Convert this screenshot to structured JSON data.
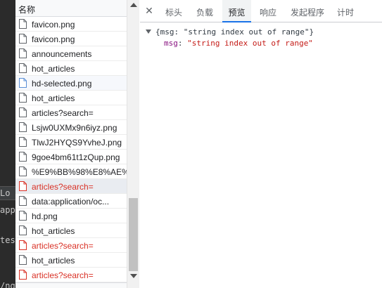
{
  "background_editor": {
    "lines": [
      "Lo",
      "app",
      "test",
      "/ng"
    ]
  },
  "network_list": {
    "header": "名称",
    "rows": [
      {
        "name": "favicon.png",
        "status": "ok"
      },
      {
        "name": "favicon.png",
        "status": "ok"
      },
      {
        "name": "announcements",
        "status": "ok"
      },
      {
        "name": "hot_articles",
        "status": "ok"
      },
      {
        "name": "hd-selected.png",
        "status": "ok"
      },
      {
        "name": "hot_articles",
        "status": "ok"
      },
      {
        "name": "articles?search=",
        "status": "ok"
      },
      {
        "name": "Lsjw0UXMx9n6iyz.png",
        "status": "ok"
      },
      {
        "name": "TlwJ2HYQS9YvheJ.png",
        "status": "ok"
      },
      {
        "name": "9goe4bm61t1zQup.png",
        "status": "ok"
      },
      {
        "name": "%E9%BB%98%E8%AE%A...",
        "status": "ok"
      },
      {
        "name": "articles?search=",
        "status": "error"
      },
      {
        "name": "data:application/oc...",
        "status": "ok"
      },
      {
        "name": "hd.png",
        "status": "ok"
      },
      {
        "name": "hot_articles",
        "status": "ok"
      },
      {
        "name": "articles?search=",
        "status": "error"
      },
      {
        "name": "hot_articles",
        "status": "ok"
      },
      {
        "name": "articles?search=",
        "status": "error"
      }
    ]
  },
  "detail": {
    "close_icon": "close-icon",
    "tabs": [
      {
        "label": "标头"
      },
      {
        "label": "负载"
      },
      {
        "label": "预览"
      },
      {
        "label": "响应"
      },
      {
        "label": "发起程序"
      },
      {
        "label": "计时"
      }
    ],
    "active_tab": "预览",
    "preview": {
      "summary": "{msg: \"string index out of range\"}",
      "key": "msg",
      "value": "\"string index out of range\""
    }
  },
  "colors": {
    "error_text": "#d93025",
    "accent": "#1a73e8"
  }
}
